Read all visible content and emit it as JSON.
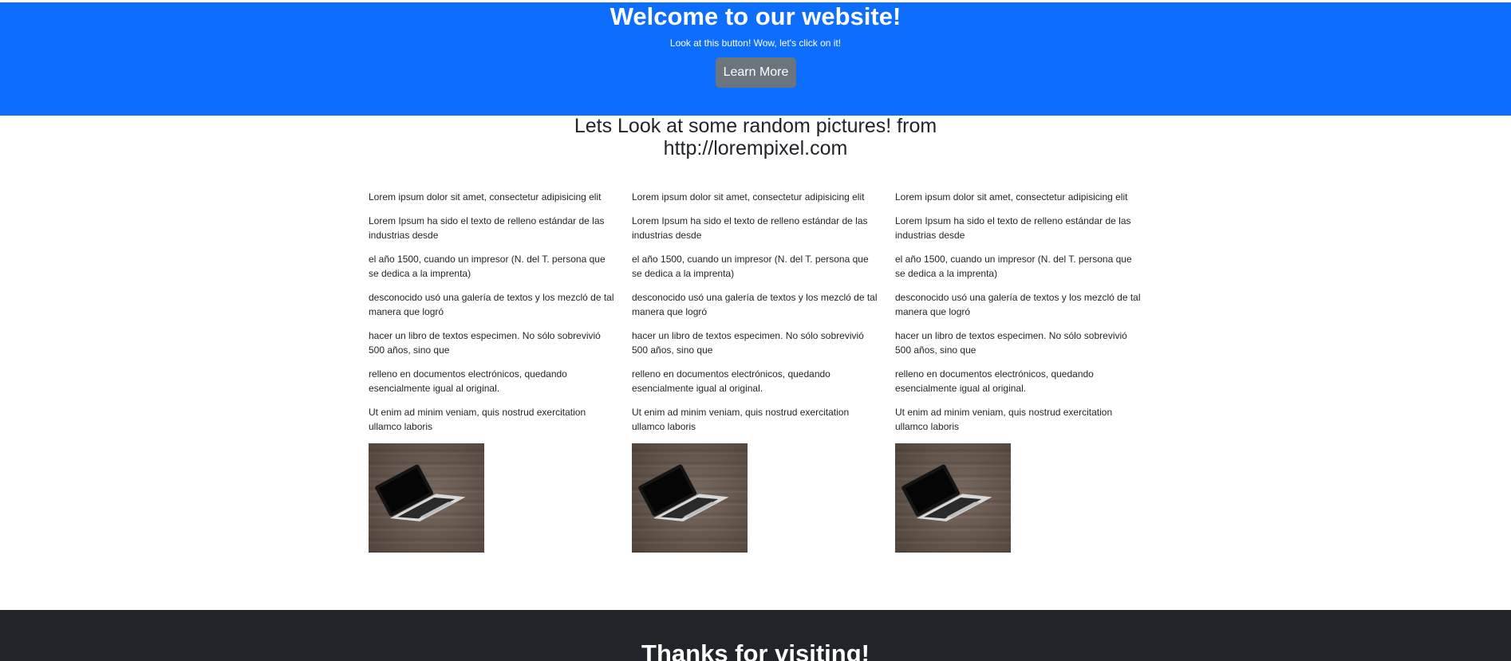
{
  "hero": {
    "title": "Welcome to our website!",
    "subtitle": "Look at this button! Wow, let's click on it!",
    "button_label": "Learn More"
  },
  "gallery": {
    "title_line1": "Lets Look at some random pictures! from",
    "title_line2": "http://lorempixel.com",
    "columns": [
      {
        "paragraphs": [
          "Lorem ipsum dolor sit amet, consectetur adipisicing elit",
          "Lorem Ipsum ha sido el texto de relleno estándar de las industrias desde",
          "el año 1500, cuando un impresor (N. del T. persona que se dedica a la imprenta)",
          "desconocido usó una galería de textos y los mezcló de tal manera que logró",
          "hacer un libro de textos especimen. No sólo sobrevivió 500 años, sino que",
          "relleno en documentos electrónicos, quedando esencialmente igual al original.",
          "Ut enim ad minim veniam, quis nostrud exercitation ullamco laboris"
        ],
        "image_icon": "laptop-photo"
      },
      {
        "paragraphs": [
          "Lorem ipsum dolor sit amet, consectetur adipisicing elit",
          "Lorem Ipsum ha sido el texto de relleno estándar de las industrias desde",
          "el año 1500, cuando un impresor (N. del T. persona que se dedica a la imprenta)",
          "desconocido usó una galería de textos y los mezcló de tal manera que logró",
          "hacer un libro de textos especimen. No sólo sobrevivió 500 años, sino que",
          "relleno en documentos electrónicos, quedando esencialmente igual al original.",
          "Ut enim ad minim veniam, quis nostrud exercitation ullamco laboris"
        ],
        "image_icon": "laptop-photo"
      },
      {
        "paragraphs": [
          "Lorem ipsum dolor sit amet, consectetur adipisicing elit",
          "Lorem Ipsum ha sido el texto de relleno estándar de las industrias desde",
          "el año 1500, cuando un impresor (N. del T. persona que se dedica a la imprenta)",
          "desconocido usó una galería de textos y los mezcló de tal manera que logró",
          "hacer un libro de textos especimen. No sólo sobrevivió 500 años, sino que",
          "relleno en documentos electrónicos, quedando esencialmente igual al original.",
          "Ut enim ad minim veniam, quis nostrud exercitation ullamco laboris"
        ],
        "image_icon": "laptop-photo"
      }
    ]
  },
  "footer": {
    "title": "Thanks for visiting!"
  },
  "colors": {
    "hero_background": "#0d6efd",
    "button_background": "#6c757d",
    "footer_background": "#212529",
    "text": "#212529"
  }
}
